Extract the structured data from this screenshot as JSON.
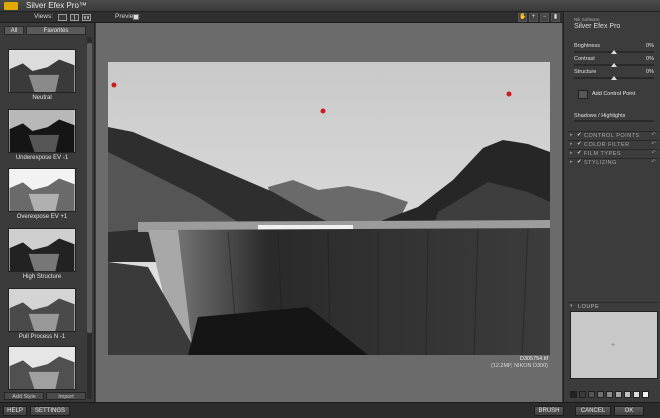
{
  "app": {
    "title": "Silver Efex Pro™"
  },
  "toolbar": {
    "views_label": "Views:",
    "view_icons": [
      "single-view-icon",
      "split-view-icon",
      "side-by-side-view-icon"
    ],
    "preview_label": "Preview:",
    "preview_checked": true,
    "tool_icons": [
      "hand-tool-icon",
      "zoom-tool-icon",
      "zoom-out-icon",
      "background-color-icon"
    ]
  },
  "sidebar": {
    "tabs": [
      "All",
      "Favorites"
    ],
    "presets": [
      {
        "label": "Neutral"
      },
      {
        "label": "Underexpose EV -1"
      },
      {
        "label": "Overexpose EV +1"
      },
      {
        "label": "High Structure"
      },
      {
        "label": "Pull Process N -1"
      },
      {
        "label": ""
      }
    ],
    "add_style": "Add Style",
    "import": "Import"
  },
  "image": {
    "filename": "D305754.tif",
    "meta": "(12.2MP, NIKON D300)",
    "control_points": 3
  },
  "panel": {
    "company": "Nik Software",
    "product": "Silver Efex Pro",
    "adjustments": [
      {
        "label": "Brightness",
        "value": "0%"
      },
      {
        "label": "Contrast",
        "value": "0%"
      },
      {
        "label": "Structure",
        "value": "0%"
      }
    ],
    "add_control_point": "Add Control Point",
    "shadows_highlights": "Shadows / Highlights",
    "sections": [
      "CONTROL POINTS",
      "COLOR FILTER",
      "FILM TYPES",
      "STYLIZING"
    ],
    "loupe": "LOUPE"
  },
  "bottom": {
    "help": "HELP",
    "settings": "SETTINGS",
    "brush": "BRUSH",
    "cancel": "CANCEL",
    "ok": "OK"
  },
  "colors": {
    "accent": "#e0a800",
    "control_point": "#c81e1e"
  }
}
